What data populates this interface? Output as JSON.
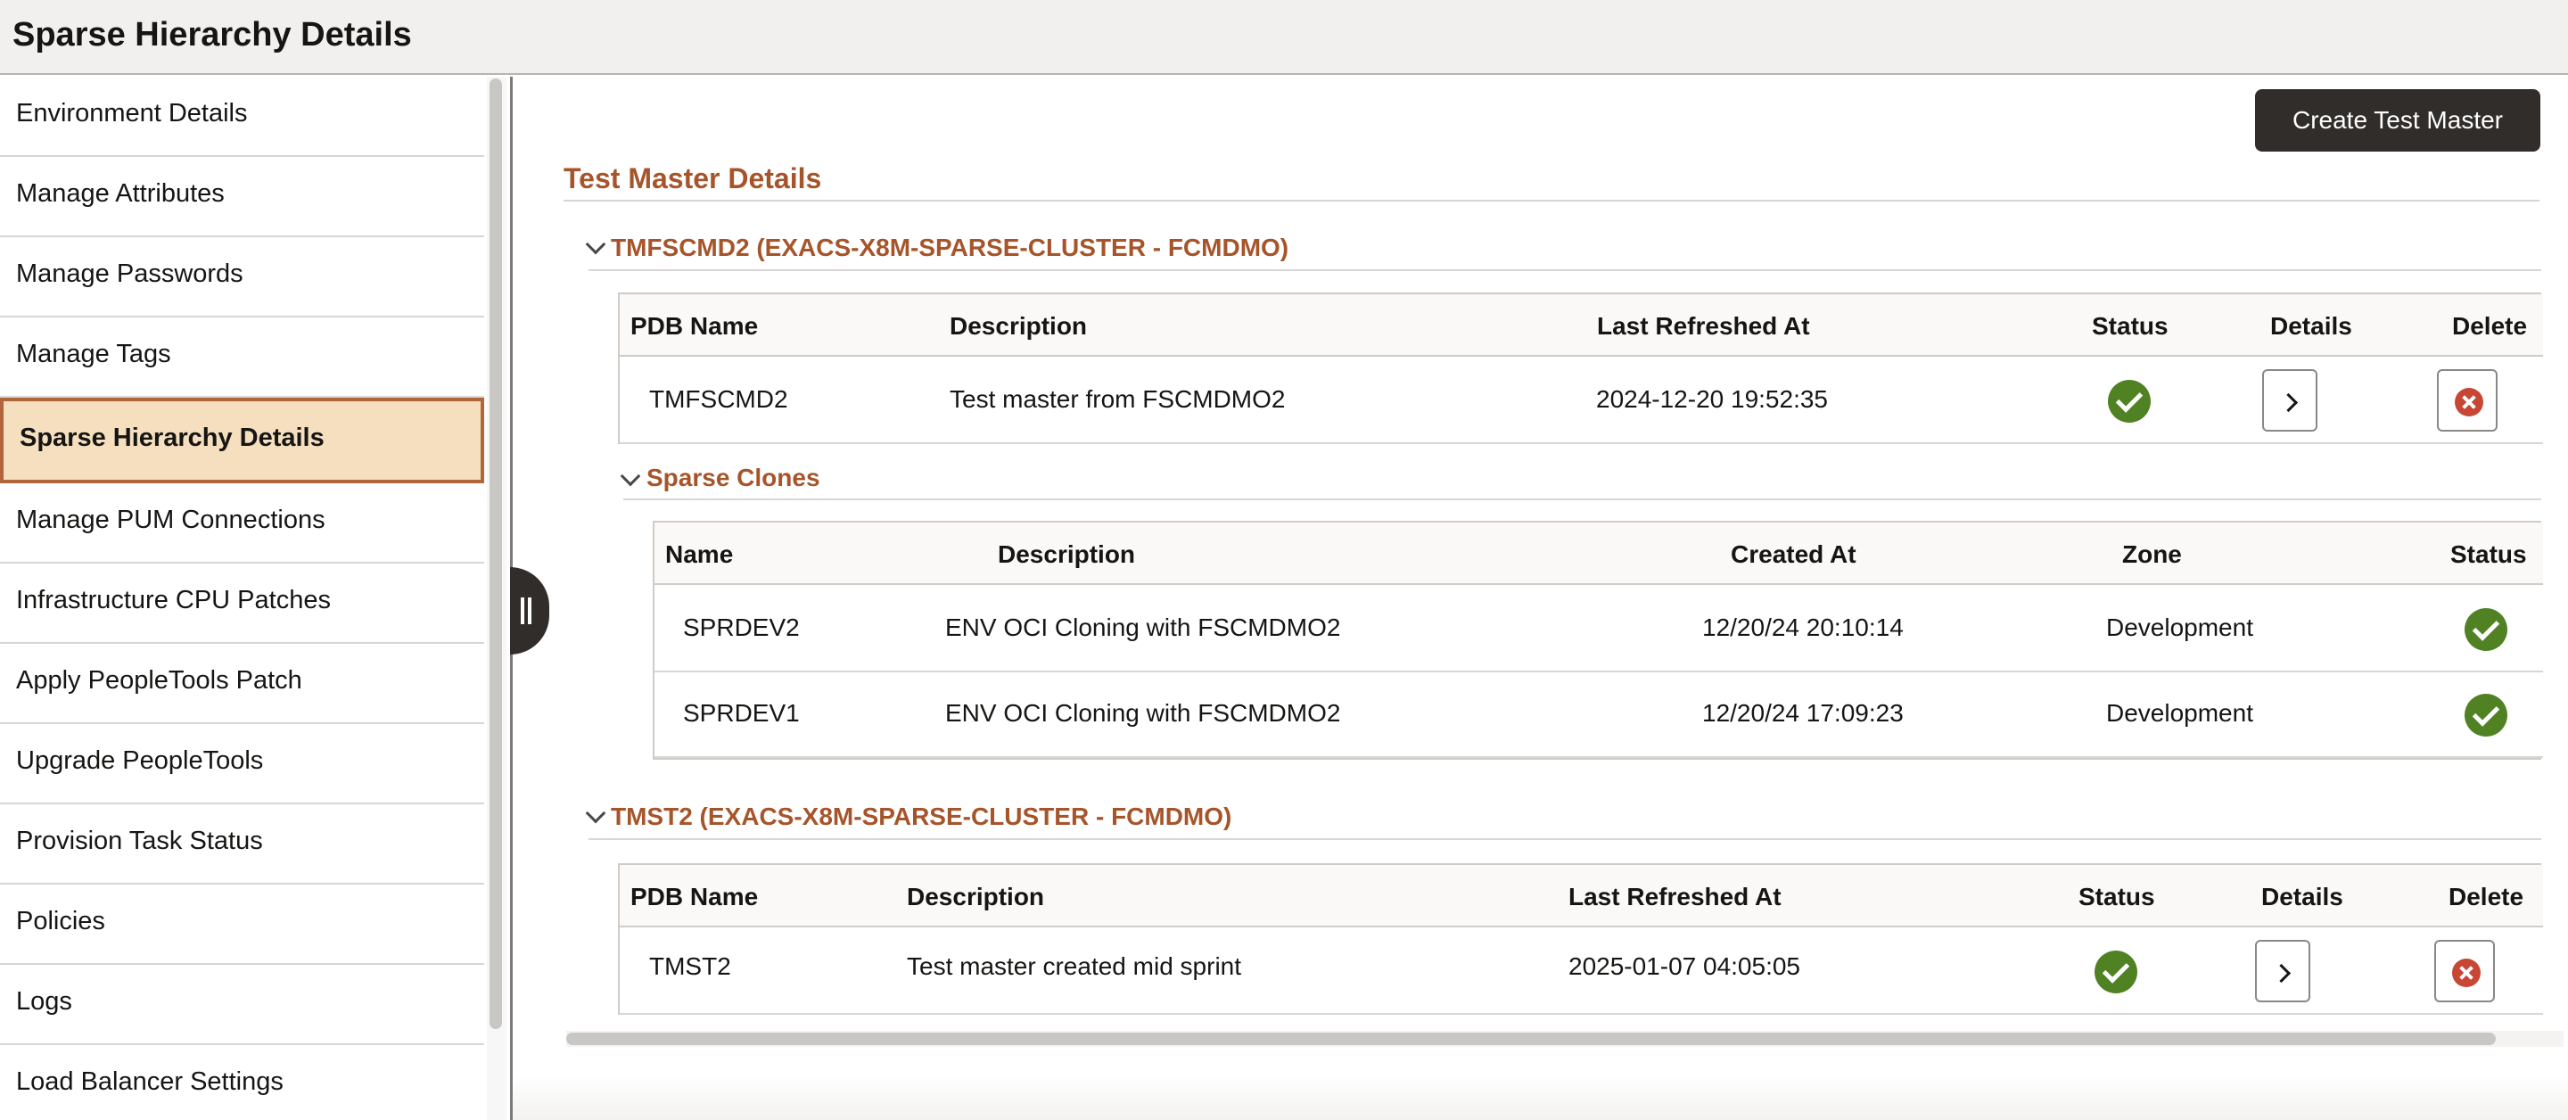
{
  "header": {
    "title": "Sparse Hierarchy Details"
  },
  "sidebar": {
    "items": [
      {
        "label": "Environment Details"
      },
      {
        "label": "Manage Attributes"
      },
      {
        "label": "Manage Passwords"
      },
      {
        "label": "Manage Tags"
      },
      {
        "label": "Sparse Hierarchy Details",
        "selected": true
      },
      {
        "label": "Manage PUM Connections"
      },
      {
        "label": "Infrastructure CPU Patches"
      },
      {
        "label": "Apply PeopleTools Patch"
      },
      {
        "label": "Upgrade PeopleTools"
      },
      {
        "label": "Provision Task Status"
      },
      {
        "label": "Policies"
      },
      {
        "label": "Logs"
      },
      {
        "label": "Load Balancer Settings"
      }
    ]
  },
  "main": {
    "create_button": "Create Test Master",
    "section_title": "Test Master Details",
    "groups": [
      {
        "title": "TMFSCMD2 (EXACS-X8M-SPARSE-CLUSTER - FCMDMO)",
        "columns": [
          "PDB Name",
          "Description",
          "Last Refreshed At",
          "Status",
          "Details",
          "Delete"
        ],
        "row": {
          "pdb_name": "TMFSCMD2",
          "description": "Test master from FSCMDMO2",
          "last_refreshed": "2024-12-20 19:52:35",
          "status": "success"
        },
        "clones": {
          "title": "Sparse Clones",
          "columns": [
            "Name",
            "Description",
            "Created At",
            "Zone",
            "Status"
          ],
          "rows": [
            {
              "name": "SPRDEV2",
              "description": "ENV OCI Cloning with FSCMDMO2",
              "created_at": "12/20/24 20:10:14",
              "zone": "Development",
              "status": "success"
            },
            {
              "name": "SPRDEV1",
              "description": "ENV OCI Cloning with FSCMDMO2",
              "created_at": "12/20/24 17:09:23",
              "zone": "Development",
              "status": "success"
            }
          ]
        }
      },
      {
        "title": "TMST2 (EXACS-X8M-SPARSE-CLUSTER - FCMDMO)",
        "columns": [
          "PDB Name",
          "Description",
          "Last Refreshed At",
          "Status",
          "Details",
          "Delete"
        ],
        "row": {
          "pdb_name": "TMST2",
          "description": "Test master created mid sprint",
          "last_refreshed": "2025-01-07 04:05:05",
          "status": "success"
        }
      }
    ]
  },
  "colors": {
    "accent": "#a6552b",
    "selected_bg": "#f5dfbf",
    "success": "#508223",
    "danger": "#c74634",
    "primary_button": "#312d2a"
  }
}
